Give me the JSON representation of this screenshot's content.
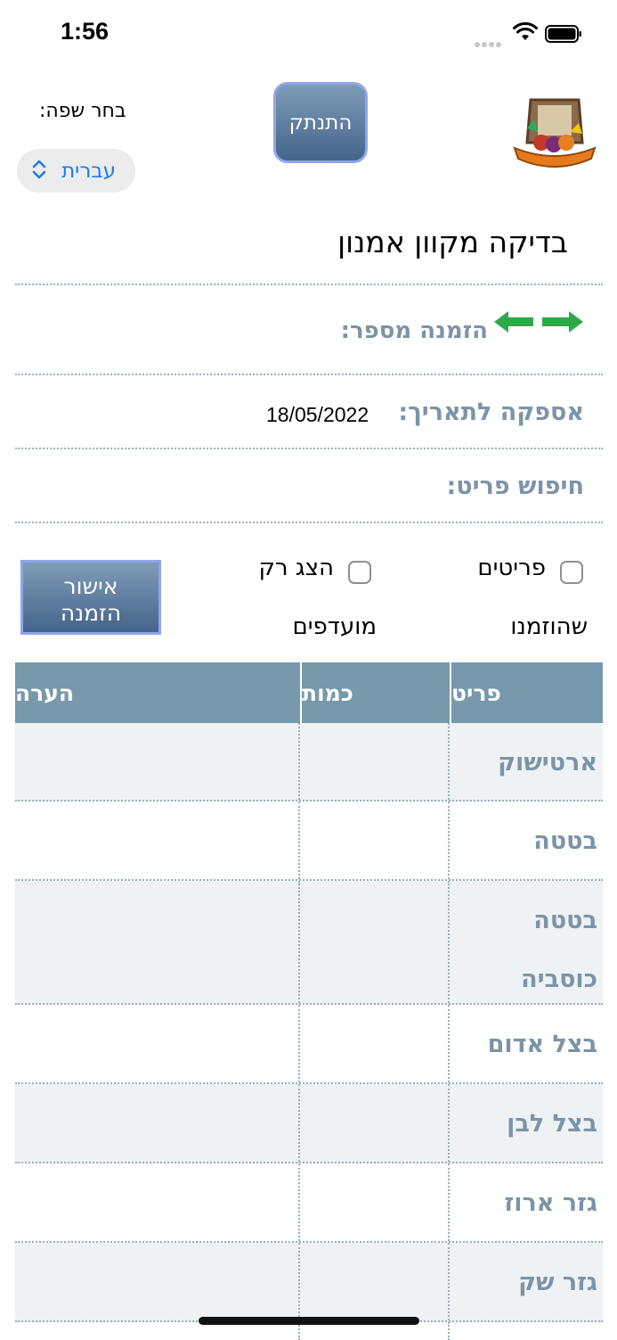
{
  "status_bar": {
    "time": "1:56"
  },
  "header": {
    "language_label": "בחר שפה:",
    "language_value": "עברית",
    "logout_label": "התנתק",
    "logo_icon": "salmon-produce-logo"
  },
  "page_title": "בדיקה מקוון אמנון",
  "order": {
    "label": "הזמנה מספר:",
    "arrows_icon": "green-double-arrow-icon"
  },
  "delivery": {
    "label": "אספקה לתאריך:",
    "date": "18/05/2022"
  },
  "search": {
    "label": "חיפוש פריט:"
  },
  "filters": {
    "ordered_items": {
      "line1": "פריטים",
      "line2": "שהוזמנו",
      "checked": false
    },
    "favorites_only": {
      "line1": "הצג רק",
      "line2": "מועדפים",
      "checked": false
    }
  },
  "confirm_button": {
    "line1": "אישור",
    "line2": "הזמנה"
  },
  "table": {
    "headers": {
      "item": "פריט",
      "quantity": "כמות",
      "note": "הערה"
    },
    "rows": [
      {
        "item": "ארטישוק",
        "quantity": "",
        "note": ""
      },
      {
        "item": "בטטה",
        "quantity": "",
        "note": ""
      },
      {
        "item": "בטטה כוסביה",
        "quantity": "",
        "note": ""
      },
      {
        "item": "בצל אדום",
        "quantity": "",
        "note": ""
      },
      {
        "item": "בצל לבן",
        "quantity": "",
        "note": ""
      },
      {
        "item": "גזר ארוז",
        "quantity": "",
        "note": ""
      },
      {
        "item": "גזר שק",
        "quantity": "",
        "note": ""
      }
    ]
  },
  "colors": {
    "accent_blue": "#1b7cf2",
    "label_slate": "#7c94a8",
    "table_header": "#7898ab",
    "arrow_green": "#2ea94a"
  }
}
